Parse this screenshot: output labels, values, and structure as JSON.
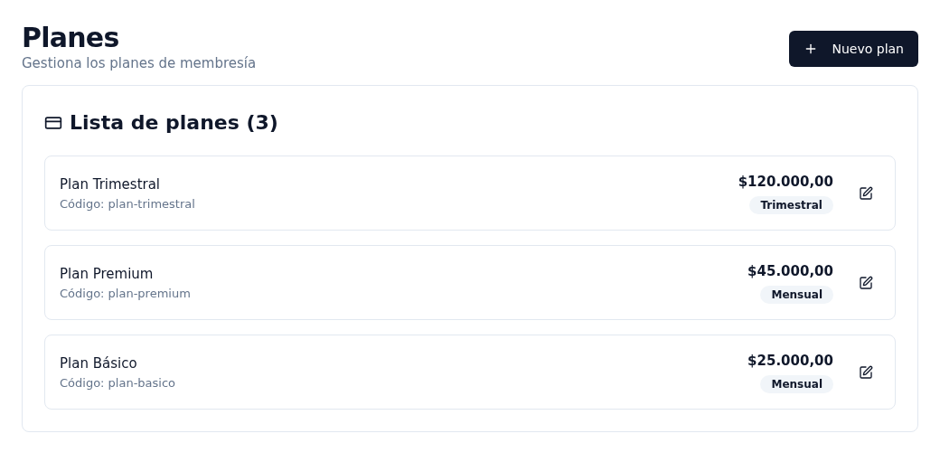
{
  "header": {
    "title": "Planes",
    "subtitle": "Gestiona los planes de membresía",
    "button": "Nuevo plan"
  },
  "list": {
    "title": "Lista de planes (3)",
    "plans": [
      {
        "name": "Plan Trimestral",
        "code": "Código: plan-trimestral",
        "price": "$120.000,00",
        "period": "Trimestral"
      },
      {
        "name": "Plan Premium",
        "code": "Código: plan-premium",
        "price": "$45.000,00",
        "period": "Mensual"
      },
      {
        "name": "Plan Básico",
        "code": "Código: plan-basico",
        "price": "$25.000,00",
        "period": "Mensual"
      }
    ]
  }
}
